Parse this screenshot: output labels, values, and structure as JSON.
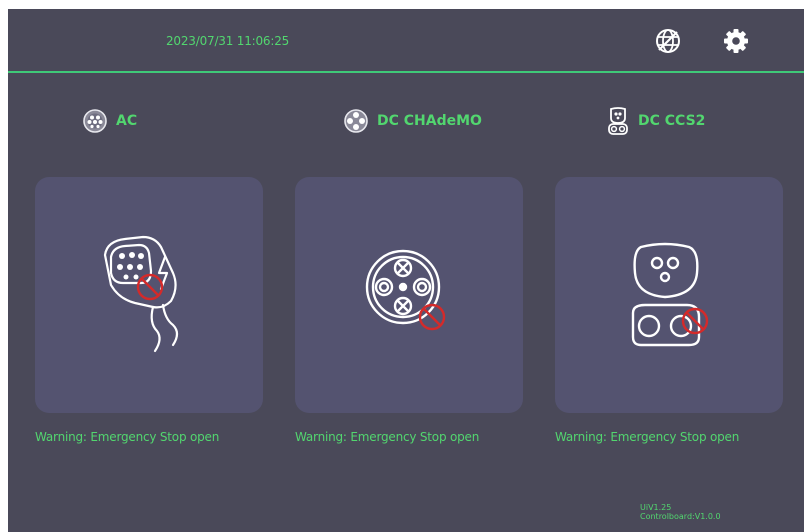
{
  "header": {
    "datetime": "2023/07/31 11:06:25",
    "icons": [
      "network-globe-icon",
      "gear-icon"
    ]
  },
  "connectors": [
    {
      "title": "AC",
      "icon": "ac-plug-icon",
      "warning": "Warning: Emergency Stop open"
    },
    {
      "title": "DC CHAdeMO",
      "icon": "chademo-plug-icon",
      "warning": "Warning: Emergency Stop open"
    },
    {
      "title": "DC CCS2",
      "icon": "ccs2-plug-icon",
      "warning": "Warning: Emergency Stop open"
    }
  ],
  "version": {
    "ui": "UiV1.25",
    "controlboard": "Controlboard:V1.0.0"
  },
  "colors": {
    "background": "#4a4959",
    "card": "#545370",
    "accent": "#52d66f",
    "prohibit": "#d42a2a"
  }
}
